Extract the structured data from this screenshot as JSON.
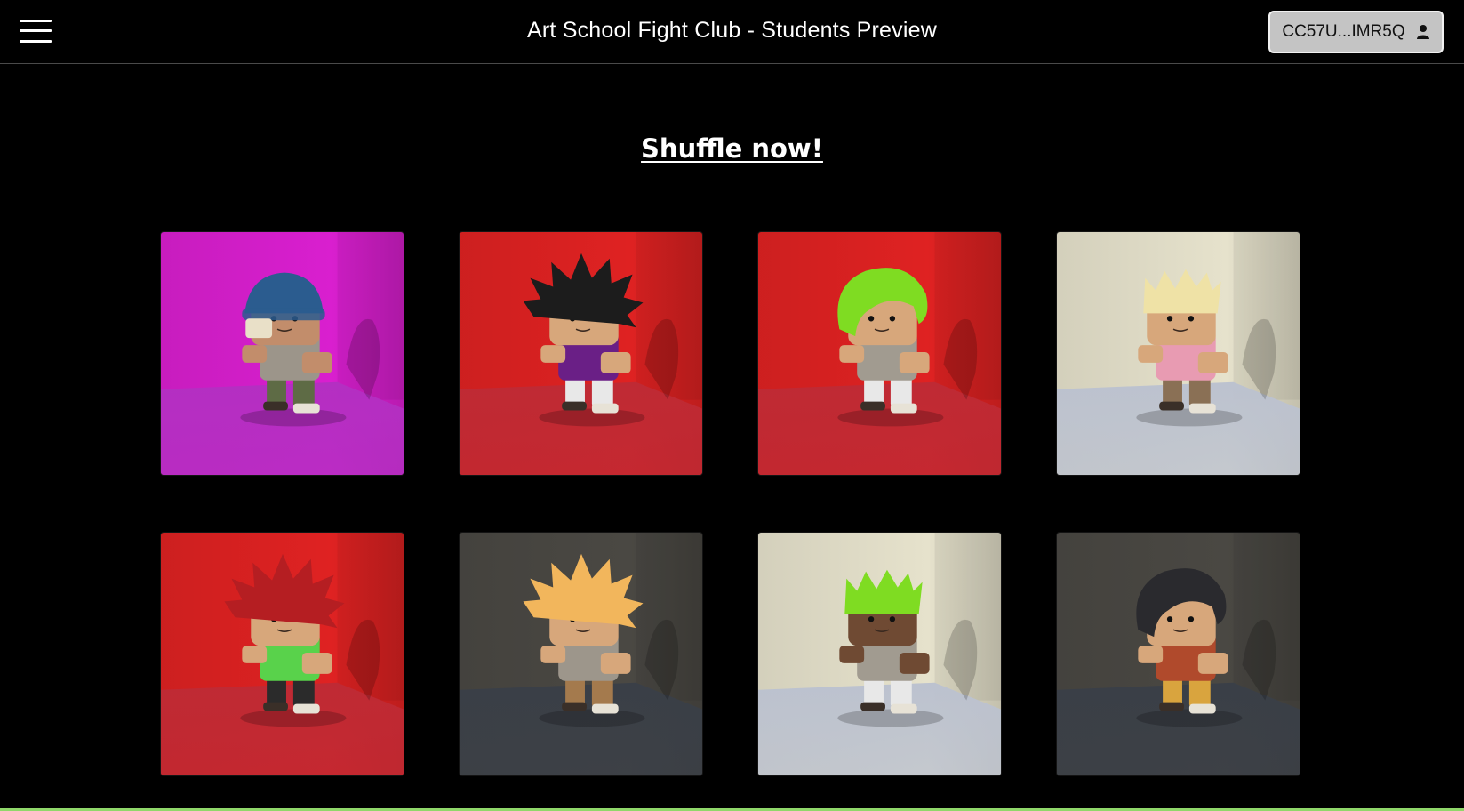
{
  "header": {
    "title": "Art School Fight Club - Students Preview",
    "menu_icon": "hamburger-menu-icon",
    "account_label": "CC57U...IMR5Q",
    "account_icon": "person-icon"
  },
  "main": {
    "shuffle_label": "Shuffle now!"
  },
  "students": [
    {
      "bg": "#d91fcf",
      "floor": "#b42fc2",
      "hair": "#2b5c8f",
      "hair_style": "beanie",
      "skin": "#c28d6b",
      "shirt": "#9c958a",
      "pants": "#5e6b45"
    },
    {
      "bg": "#df2222",
      "floor": "#bf2a34",
      "hair": "#1c1c1c",
      "hair_style": "spiky",
      "skin": "#d7a77b",
      "shirt": "#6a1f86",
      "pants": "#e8e8e8"
    },
    {
      "bg": "#df2222",
      "floor": "#bf2a34",
      "hair": "#7fdc22",
      "hair_style": "swoop",
      "skin": "#d7a77b",
      "shirt": "#a19b90",
      "pants": "#e8e8e8"
    },
    {
      "bg": "#e6e2cc",
      "floor": "#bcc2cf",
      "hair": "#efe2a6",
      "hair_style": "crown",
      "skin": "#d7a77b",
      "shirt": "#e89bb2",
      "pants": "#8a7055"
    },
    {
      "bg": "#df2222",
      "floor": "#bf2a34",
      "hair": "#b51e22",
      "hair_style": "spiky",
      "skin": "#d7a77b",
      "shirt": "#59d24b",
      "pants": "#2b2b2b"
    },
    {
      "bg": "#4a4843",
      "floor": "#3a3f47",
      "hair": "#f2b65c",
      "hair_style": "spiky",
      "skin": "#d7a77b",
      "shirt": "#9d968b",
      "pants": "#a47a4d"
    },
    {
      "bg": "#e6e2cc",
      "floor": "#bcc2cf",
      "hair": "#7fdc22",
      "hair_style": "crown",
      "skin": "#6f4a33",
      "shirt": "#a19b90",
      "pants": "#e8e8e8"
    },
    {
      "bg": "#4a4843",
      "floor": "#3a3f47",
      "hair": "#2a2a2e",
      "hair_style": "swoop",
      "skin": "#d7a77b",
      "shirt": "#b04a2c",
      "pants": "#d9a43e"
    }
  ],
  "colors": {
    "background": "#000000",
    "accent": "#8fd76a",
    "wallet_button": "#c4c4c4"
  }
}
